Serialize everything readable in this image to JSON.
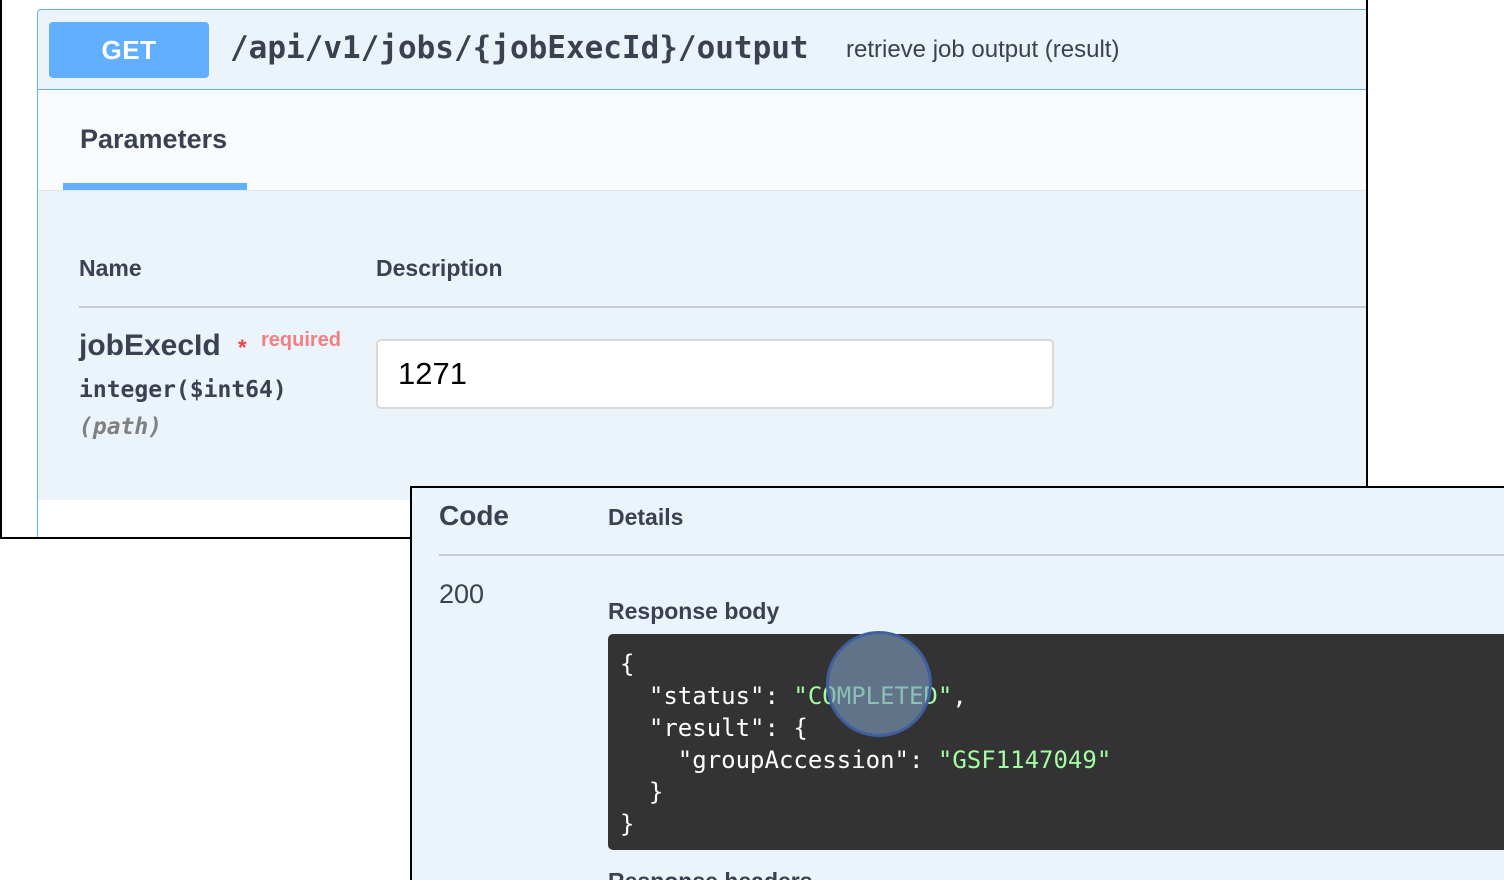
{
  "operation": {
    "method": "GET",
    "path": "/api/v1/jobs/{jobExecId}/output",
    "summary": "retrieve job output (result)"
  },
  "tabs": [
    {
      "label": "Parameters",
      "active": true
    }
  ],
  "parameters_table": {
    "headers": {
      "name": "Name",
      "description": "Description"
    },
    "rows": [
      {
        "name": "jobExecId",
        "required_mark": "*",
        "required_label": "required",
        "type": "integer($int64)",
        "in": "(path)",
        "value": "1271"
      }
    ]
  },
  "responses": {
    "headers": {
      "code": "Code",
      "details": "Details"
    },
    "items": [
      {
        "code": "200",
        "body_label": "Response body",
        "body_lines": [
          "{",
          "  \"status\": \"COMPLETED\",",
          "  \"result\": {",
          "    \"groupAccession\": \"GSF1147049\"",
          "  }",
          "}"
        ],
        "headers_label": "Response headers"
      }
    ]
  },
  "colors": {
    "method_get": "#61affe",
    "required": "#f93e3e",
    "code_bg": "#333333",
    "json_string": "#a2fca2"
  }
}
